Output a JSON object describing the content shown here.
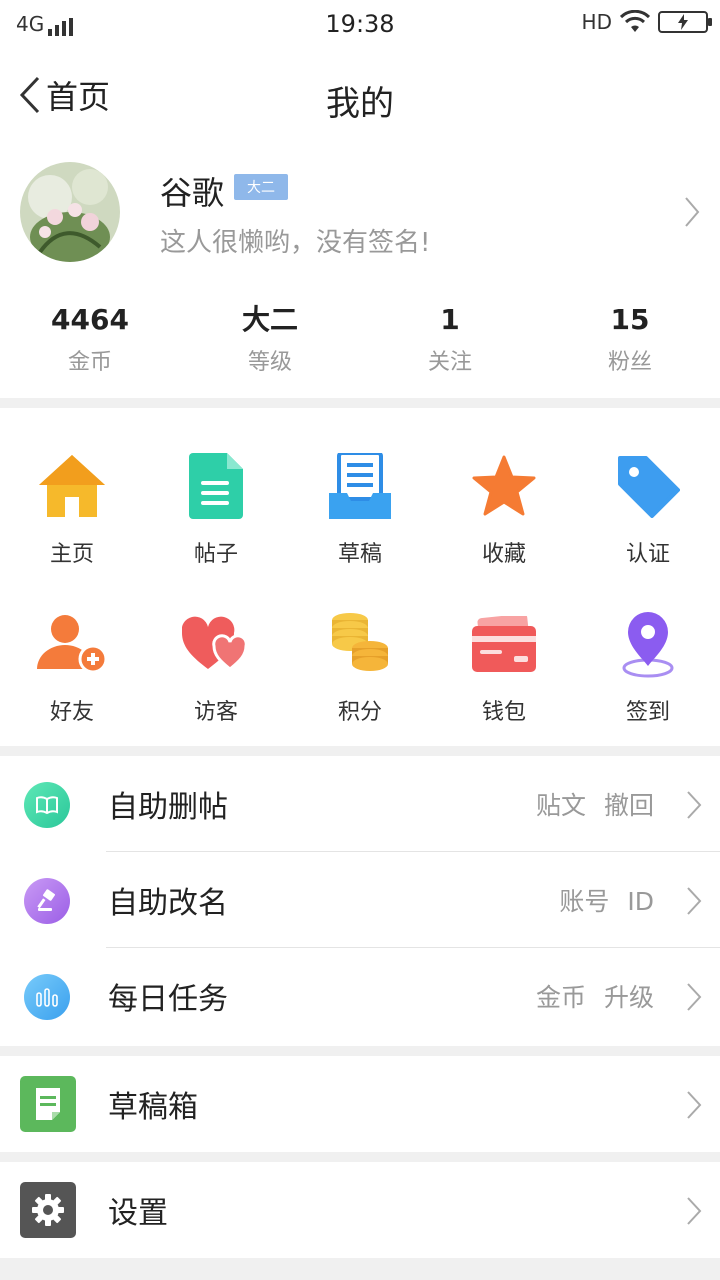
{
  "status": {
    "network": "4G",
    "time": "19:38",
    "hd": "HD",
    "battery_icon": "charging-battery-icon"
  },
  "nav": {
    "back_label": "首页",
    "title": "我的"
  },
  "profile": {
    "name": "谷歌",
    "level_badge": "大二",
    "signature": "这人很懒哟，没有签名!",
    "stats": [
      {
        "value": "4464",
        "label": "金币"
      },
      {
        "value": "大二",
        "label": "等级"
      },
      {
        "value": "1",
        "label": "关注"
      },
      {
        "value": "15",
        "label": "粉丝"
      }
    ]
  },
  "grid": {
    "items": [
      {
        "label": "主页",
        "icon": "home-icon"
      },
      {
        "label": "帖子",
        "icon": "document-icon"
      },
      {
        "label": "草稿",
        "icon": "draft-tray-icon"
      },
      {
        "label": "收藏",
        "icon": "star-icon"
      },
      {
        "label": "认证",
        "icon": "tag-icon"
      },
      {
        "label": "好友",
        "icon": "add-friend-icon"
      },
      {
        "label": "访客",
        "icon": "hearts-icon"
      },
      {
        "label": "积分",
        "icon": "coins-icon"
      },
      {
        "label": "钱包",
        "icon": "wallet-icon"
      },
      {
        "label": "签到",
        "icon": "location-pin-icon"
      }
    ]
  },
  "list": {
    "self_delete": {
      "label": "自助删帖",
      "hint": "贴文 撤回",
      "icon": "book-icon",
      "color": "#3dd6a5"
    },
    "self_rename": {
      "label": "自助改名",
      "hint": "账号 ID",
      "icon": "gavel-icon",
      "color": "#b277e8"
    },
    "daily_tasks": {
      "label": "每日任务",
      "hint": "金币 升级",
      "icon": "bar-chart-icon",
      "color": "#4fb4f5"
    },
    "drafts_box": {
      "label": "草稿箱",
      "icon": "note-icon",
      "color": "#5cb85c"
    },
    "settings": {
      "label": "设置",
      "icon": "gear-icon",
      "color": "#555555"
    }
  }
}
